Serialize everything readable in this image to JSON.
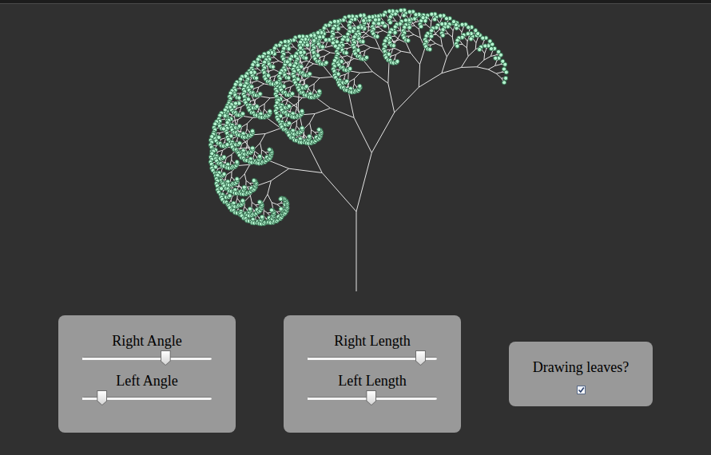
{
  "panels": [
    {
      "sliders": [
        {
          "label": "Right Angle",
          "level": 0.64
        },
        {
          "label": "Left Angle",
          "level": 0.15
        }
      ]
    },
    {
      "sliders": [
        {
          "label": "Right Length",
          "level": 0.87
        },
        {
          "label": "Left Length",
          "level": 0.49
        }
      ]
    }
  ],
  "leaves": {
    "label": "Drawing leaves?",
    "checked": true
  }
}
